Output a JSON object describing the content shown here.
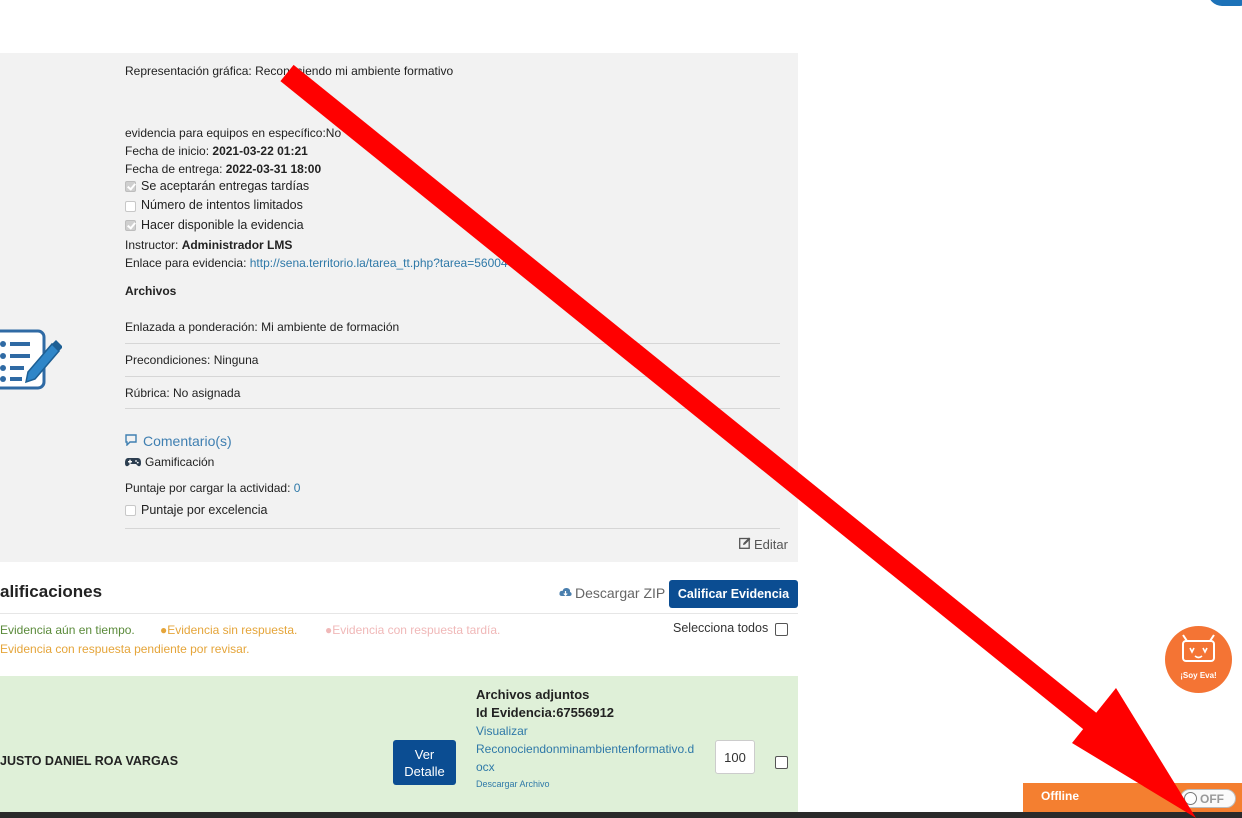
{
  "evidence": {
    "representation": "Representación gráfica: Reconociendo mi ambiente formativo",
    "team_evidence": "evidencia para equipos en específico:No",
    "start_label": "Fecha de inicio: ",
    "start_value": "2021-03-22 01:21",
    "due_label": "Fecha de entrega: ",
    "due_value": "2022-03-31 18:00",
    "late_label": "Se aceptarán entregas tardías",
    "attempts_label": "Número de intentos limitados",
    "available_label": "Hacer disponible la evidencia",
    "instructor_label": "Instructor: ",
    "instructor_value": "Administrador LMS",
    "link_label": "Enlace para evidencia: ",
    "link_value": "http://sena.territorio.la/tarea_tt.php?tarea=56004",
    "files_heading": "Archivos",
    "weighting": "Enlazada a ponderación: Mi ambiente de formación",
    "preconditions": "Precondiciones: Ninguna",
    "rubric": "Rúbrica: No asignada",
    "comments": "Comentario(s)",
    "gamification": "Gamificación",
    "points_label": "Puntaje por cargar la actividad: ",
    "points_value": "0",
    "excellence_label": "Puntaje por excelencia",
    "edit": "Editar"
  },
  "grades": {
    "title": "alificaciones",
    "download_zip": "Descargar ZIP",
    "grade_button": "Calificar Evidencia",
    "legend": [
      {
        "text": "Evidencia aún en tiempo.",
        "color": "#5a8a3a"
      },
      {
        "text": "●Evidencia sin respuesta.",
        "color": "#e5a53a"
      },
      {
        "text": "●Evidencia con respuesta tardía.",
        "color": "#f0b8b8"
      },
      {
        "text": "Evidencia con respuesta pendiente por revisar.",
        "color": "#e5a53a"
      }
    ],
    "select_all": "Selecciona todos",
    "row": {
      "student": "JUSTO DANIEL ROA VARGAS",
      "detail_button_line1": "Ver",
      "detail_button_line2": "Detalle",
      "attachments_title": "Archivos adjuntos",
      "evidence_id": "Id Evidencia:67556912",
      "view_link": "Visualizar",
      "file_line1": "Reconociendonminambientenformativo.d",
      "file_line2": "ocx",
      "download_link": "Descargar Archivo",
      "score": "100"
    }
  },
  "widgets": {
    "offline_label": "Offline",
    "toggle_label": "OFF",
    "eva_label": "¡Soy Eva!"
  },
  "colors": {
    "primary_button": "#0b4d92",
    "link": "#2f79a8",
    "row_bg": "#dff0d8",
    "offline_bar": "#f47f30",
    "annotation_arrow": "#ff0000"
  }
}
